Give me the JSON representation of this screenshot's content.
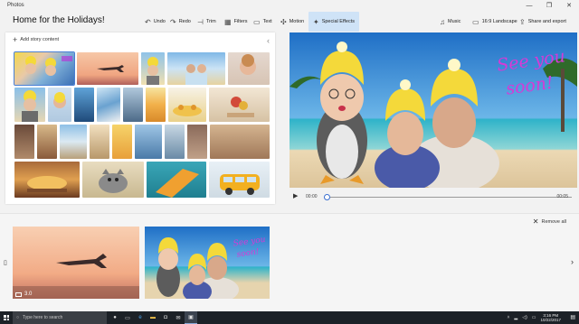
{
  "window": {
    "app_name": "Photos",
    "controls": [
      "—",
      "❐",
      "✕"
    ]
  },
  "project": {
    "title": "Home for the Holidays!"
  },
  "toolbar": {
    "undo": "Undo",
    "redo": "Redo",
    "trim": "Trim",
    "filters": "Filters",
    "text": "Text",
    "motion": "Motion",
    "special_effects": "Special Effects",
    "music": "Music",
    "landscape": "16:9 Landscape",
    "share": "Share and export"
  },
  "library": {
    "add_label": "Add story content"
  },
  "preview": {
    "overlay_text": "See you soon!",
    "time_current": "00:00",
    "time_total": "00:05"
  },
  "storyboard": {
    "remove_all": "Remove all",
    "cards": [
      {
        "duration": "3.0"
      }
    ]
  },
  "taskbar": {
    "search_placeholder": "Type here to search",
    "time": "3:16 PM",
    "date": "10/22/2017"
  },
  "colors": {
    "accent": "#3a6fd0",
    "active_tool_bg": "#cfe3f7",
    "overlay_text": "#d63ad6",
    "hat": "#f4d93a"
  }
}
